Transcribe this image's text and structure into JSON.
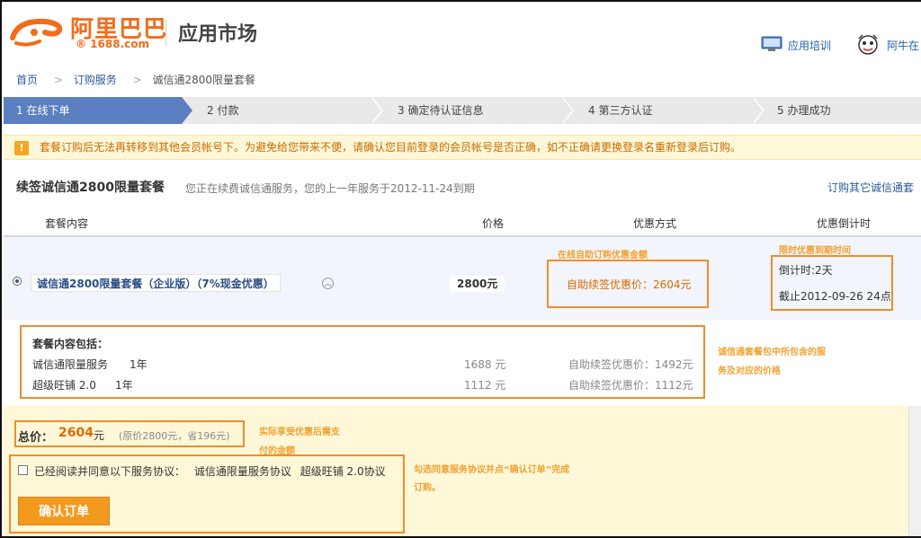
{
  "header": {
    "logo_cn": "阿里巴巴",
    "logo_en": "® 1688.com",
    "app_title": "应用市场",
    "training_link": "应用培训",
    "aniu_link": "阿牛在"
  },
  "breadcrumb": [
    "首页",
    "订购服务",
    "诚信通2800限量套餐"
  ],
  "steps": [
    "1 在线下单",
    "2 付款",
    "3 确定待认证信息",
    "4 第三方认证",
    "5 办理成功"
  ],
  "notice": {
    "icon": "!",
    "text": "套餐订购后无法再转移到其他会员帐号下。为避免给您带来不便，请确认您目前登录的会员帐号是否正确，如不正确请更换登录名重新登录后订购。"
  },
  "section": {
    "title": "续签诚信通2800限量套餐",
    "subtitle": "您正在续费诚信通服务，您的上一年服务于2012-11-24到期",
    "other_link": "订购其它诚信通套"
  },
  "table_headers": [
    "套餐内容",
    "价格",
    "优惠方式",
    "优惠倒计时"
  ],
  "package": {
    "name": "诚信通2800限量套餐（企业版）（7%现金优惠）",
    "price": "2800元",
    "discount": "自助续签优惠价：2604元",
    "countdown_label": "倒计时:2天",
    "deadline": "截止2012-09-26 24点"
  },
  "contents": {
    "title": "套餐内容包括：",
    "items": [
      {
        "name": "诚信通限量服务",
        "period": "1年",
        "price": "1688 元",
        "discount": "自助续签优惠价：1492元"
      },
      {
        "name": "超级旺铺 2.0",
        "period": "1年",
        "price": "1112 元",
        "discount": "自助续签优惠价：1112元"
      }
    ]
  },
  "total": {
    "label": "总价：",
    "value": "2604",
    "unit": "元",
    "original": "(原价2800元，省196元)"
  },
  "agreement": {
    "text": "已经阅读并同意以下服务协议：",
    "link1": "诚信通限量服务协议",
    "link2": "超级旺铺 2.0协议"
  },
  "confirm_label": "确认订单",
  "annotations": {
    "discount_note": "在线自助订购优惠金额",
    "countdown_note": "限时优惠到期时间",
    "contents_note_1": "诚信通套餐包中所包含的服",
    "contents_note_2": "务及对应的价格",
    "total_note_1": "实际享受优惠后需支",
    "total_note_2": "付的金额",
    "confirm_note_1": "勾选同意服务协议并点“确认订单”完成",
    "confirm_note_2": "订购。"
  },
  "colors": {
    "brand_orange": "#f26c1a",
    "active_step": "#5b7fc0",
    "highlight_box": "#f08c2c",
    "notice_bg": "#fef8d8"
  }
}
